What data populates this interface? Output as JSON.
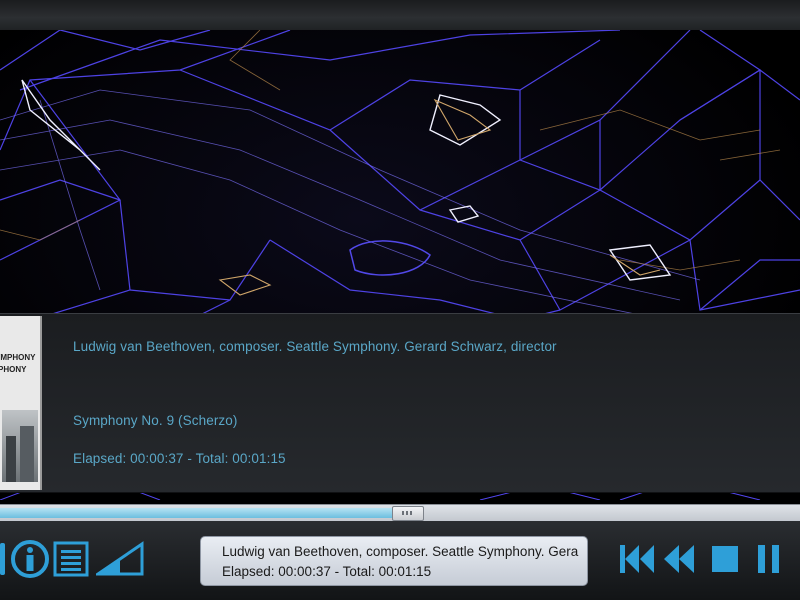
{
  "info": {
    "artist_line": "Ludwig van Beethoven, composer. Seattle Symphony. Gerard Schwarz, director",
    "track_title": "Symphony No. 9 (Scherzo)",
    "time_line": "Elapsed: 00:00:37 - Total: 00:01:15"
  },
  "album_art": {
    "text_lines": [
      "YMPHONY",
      "PHONY"
    ]
  },
  "playback": {
    "elapsed": "00:00:37",
    "total": "00:01:15",
    "progress_fraction": 0.49
  },
  "now_playing": {
    "line1": "Ludwig van Beethoven, composer. Seattle Symphony. Gera",
    "line2": "Elapsed: 00:00:37 - Total: 00:01:15"
  },
  "controls": {
    "left": [
      "partial-icon",
      "info-icon",
      "playlist-icon",
      "volume-icon"
    ],
    "right": [
      "skip-previous-icon",
      "rewind-icon",
      "stop-icon",
      "pause-icon"
    ]
  },
  "colors": {
    "accent_blue": "#5aa7c7",
    "control_cyan": "#2e9fd8",
    "viz_lines": "#5b4ff5"
  }
}
